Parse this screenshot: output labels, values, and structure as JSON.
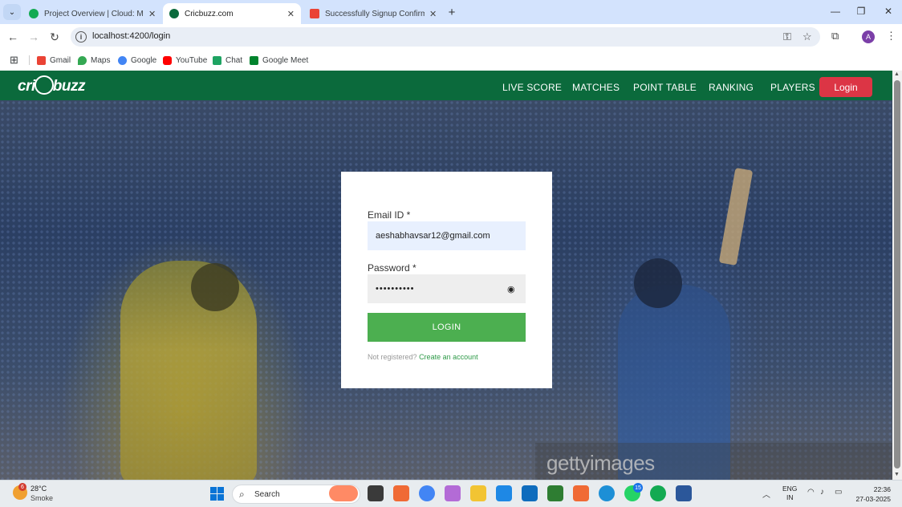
{
  "browser": {
    "tabs": [
      {
        "label": "Project Overview | Cloud: Mong",
        "favicon_color": "#13aa52",
        "active": false
      },
      {
        "label": "Cricbuzz.com",
        "favicon_color": "#0b6a3c",
        "active": true
      },
      {
        "label": "Successfully Signup Confirmati",
        "favicon_color": "#ea4335",
        "active": false
      }
    ],
    "url": "localhost:4200/login",
    "bookmarks": [
      {
        "label": "Gmail",
        "color": "#ea4335"
      },
      {
        "label": "Maps",
        "color": "#34a853"
      },
      {
        "label": "Google",
        "color": "#4285f4"
      },
      {
        "label": "YouTube",
        "color": "#ff0000"
      },
      {
        "label": "Chat",
        "color": "#1ea362"
      },
      {
        "label": "Google Meet",
        "color": "#00832d"
      }
    ],
    "profile_initial": "A"
  },
  "site": {
    "logo": {
      "pre": "cri",
      "post": "buzz"
    },
    "nav": [
      "LIVE SCORE",
      "MATCHES",
      "POINT TABLE",
      "RANKING",
      "PLAYERS"
    ],
    "login_button": "Login",
    "watermark": "gettyimages",
    "colors": {
      "navbar": "#0b6a3c",
      "login_red": "#dc3545",
      "submit_green": "#4caf50",
      "link_green": "#2e9a48"
    }
  },
  "login_form": {
    "email_label": "Email ID *",
    "email_value": "aeshabhavsar12@gmail.com",
    "password_label": "Password *",
    "password_value": "••••••••••",
    "submit_label": "LOGIN",
    "register_prompt": "Not registered?",
    "register_link": "Create an account"
  },
  "taskbar": {
    "weather_temp": "28°C",
    "weather_desc": "Smoke",
    "weather_badge": "6",
    "search_label": "Search",
    "lang_line1": "ENG",
    "lang_line2": "IN",
    "time": "22:36",
    "date": "27-03-2025",
    "whatsapp_badge": "15"
  }
}
